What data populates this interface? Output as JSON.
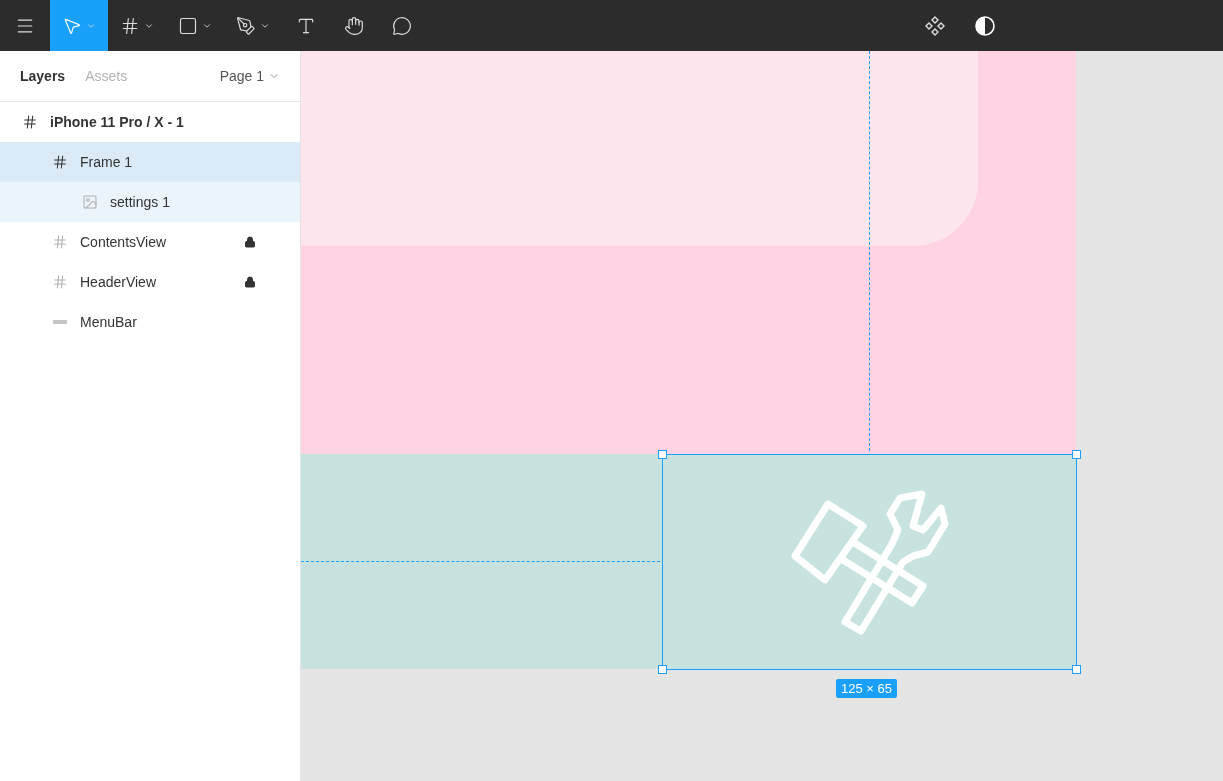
{
  "toolbar": {
    "tools": [
      {
        "kind": "menu",
        "selected": false,
        "caret": false
      },
      {
        "kind": "move",
        "selected": true,
        "caret": true
      },
      {
        "kind": "frame",
        "selected": false,
        "caret": true
      },
      {
        "kind": "rectangle",
        "selected": false,
        "caret": true
      },
      {
        "kind": "pen",
        "selected": false,
        "caret": true
      },
      {
        "kind": "text",
        "selected": false,
        "caret": false
      },
      {
        "kind": "hand",
        "selected": false,
        "caret": false
      },
      {
        "kind": "comment",
        "selected": false,
        "caret": false
      }
    ],
    "right_tools": [
      {
        "kind": "component"
      },
      {
        "kind": "contrast"
      }
    ]
  },
  "sidebar": {
    "tabs": [
      {
        "label": "Layers",
        "selected": true
      },
      {
        "label": "Assets",
        "selected": false
      }
    ],
    "page": "Page 1",
    "layers": [
      {
        "name": "iPhone 11 Pro / X - 1",
        "kind": "frame",
        "selected": false,
        "locked": false,
        "children": [
          {
            "name": "Frame 1",
            "kind": "frame",
            "selected": true,
            "locked": false,
            "children": [
              {
                "name": "settings 1",
                "kind": "image",
                "selected": false,
                "locked": false
              }
            ]
          },
          {
            "name": "ContentsView",
            "kind": "frame",
            "selected": false,
            "locked": true
          },
          {
            "name": "HeaderView",
            "kind": "frame",
            "selected": false,
            "locked": true
          },
          {
            "name": "MenuBar",
            "kind": "line",
            "selected": false,
            "locked": false
          }
        ]
      }
    ]
  },
  "canvas": {
    "selection_size": "125 × 65"
  }
}
